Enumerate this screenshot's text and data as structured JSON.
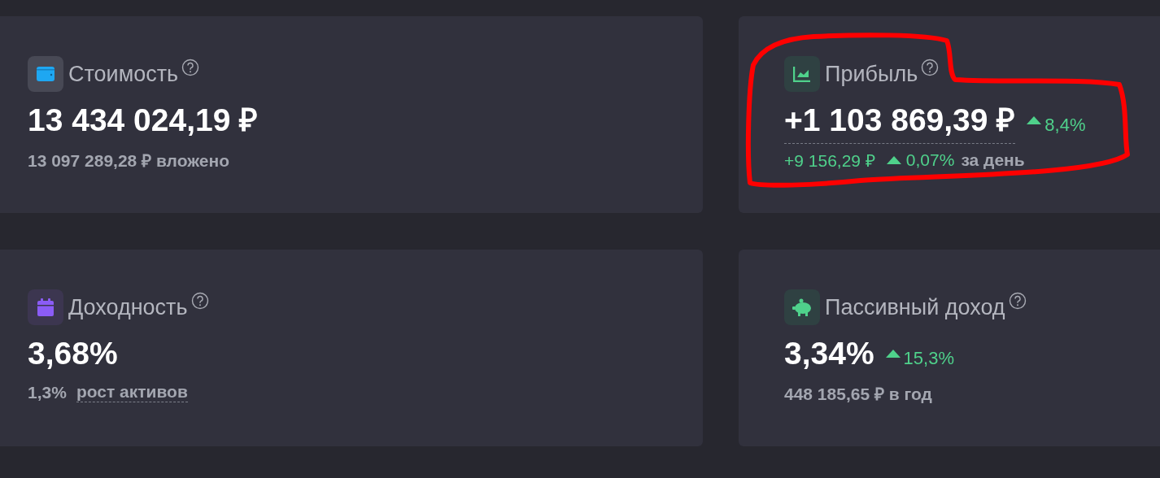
{
  "cards": [
    {
      "kind": "wallet",
      "title": "Стоимость",
      "value": "13 434 024,19 ₽",
      "value_underlined": false,
      "highlighted": false,
      "sub": [
        {
          "kind": "text",
          "text": "13 097 289,28 ₽ вложено"
        }
      ]
    },
    {
      "kind": "chart",
      "title": "Прибыль",
      "value": "+1 103 869,39 ₽",
      "value_underlined": true,
      "highlighted": true,
      "change": "8,4%",
      "sub": [
        {
          "kind": "positive",
          "text": "+9 156,29 ₽"
        },
        {
          "kind": "rise",
          "text": "0,07%"
        },
        {
          "kind": "text",
          "text": "за день"
        }
      ]
    },
    {
      "kind": "calendar",
      "title": "Доходность",
      "value": "3,68%",
      "value_underlined": false,
      "highlighted": false,
      "sub": [
        {
          "kind": "text",
          "text": "1,3%"
        },
        {
          "kind": "dotted",
          "text": "рост активов"
        }
      ]
    },
    {
      "kind": "piggy",
      "title": "Пассивный доход",
      "value": "3,34%",
      "value_underlined": false,
      "highlighted": false,
      "change": "15,3%",
      "sub": [
        {
          "kind": "text",
          "text": "448 185,65 ₽ в год"
        }
      ]
    }
  ]
}
